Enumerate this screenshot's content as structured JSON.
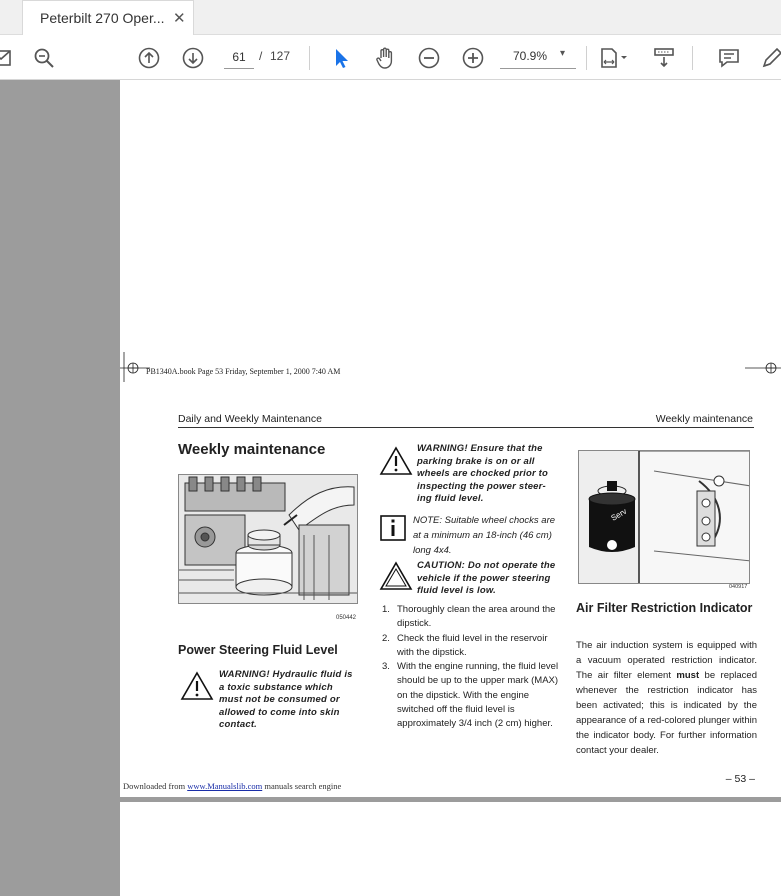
{
  "tab": {
    "title": "Peterbilt 270 Oper...",
    "close": "✕"
  },
  "toolbar": {
    "current_page": "61",
    "separator": "/",
    "total_pages": "127",
    "zoom": "70.9%",
    "zoom_caret": "▾",
    "icons": [
      "mail-icon",
      "zoom-search-icon",
      "page-up-icon",
      "page-down-icon",
      "select-arrow-icon",
      "hand-tool-icon",
      "zoom-out-icon",
      "zoom-in-icon",
      "fit-page-icon",
      "scroll-mode-icon",
      "comment-icon",
      "pen-icon"
    ],
    "accent": "#1a73e8"
  },
  "document": {
    "book_line": "PB1340A.book  Page 53  Friday, September 1, 2000  7:40 AM",
    "running_head_left": "Daily and Weekly Maintenance",
    "running_head_right": "Weekly maintenance",
    "title": "Weekly maintenance",
    "figure1_label": "050442",
    "section_psf": "Power Steering Fluid Level",
    "psf_warning": "WARNING! Hydraulic fluid is a toxic substance which must not be consumed or allowed to come into skin contact.",
    "mid_warning": "WARNING! Ensure that the parking brake is on or all wheels are chocked prior to inspecting the power steer-ing fluid level.",
    "mid_note": "NOTE: Suitable wheel chocks are at a minimum an 18-inch (46 cm) long 4x4.",
    "mid_caution": "CAUTION: Do not operate the vehicle if the power steering fluid level is low.",
    "steps": [
      {
        "num": "1.",
        "text": "Thoroughly clean the area around the dipstick."
      },
      {
        "num": "2.",
        "text": "Check the fluid level in the reservoir with the dipstick."
      },
      {
        "num": "3.",
        "text": "With the engine running, the fluid level should be up to the upper mark (MAX) on the dipstick. With the engine switched off the fluid level is approximately 3/4 inch (2 cm) higher."
      }
    ],
    "figure2_label": "040917",
    "section_afr": "Air Filter Restriction Indicator",
    "afr_body_1": "The air induction system is equipped with a vacuum operated restriction indicator. The air filter element ",
    "afr_body_bold": "must",
    "afr_body_2": " be replaced whenever the restriction indicator has been activated; this is indicated by the appearance of a red-colored plunger within the indicator body. For further information contact your dealer.",
    "page_number": "– 53 –",
    "download_prefix": "Downloaded from ",
    "download_link": "www.Manualslib.com",
    "download_suffix": "  manuals search engine"
  }
}
